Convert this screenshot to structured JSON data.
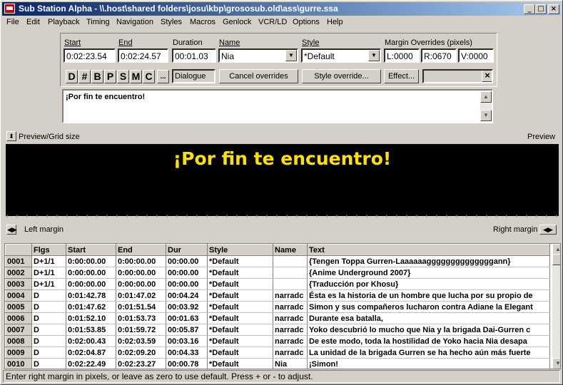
{
  "window": {
    "title": "Sub Station Alpha - \\\\.host\\shared folders\\josu\\kbp\\grososub.old\\ass\\gurre.ssa",
    "min": "_",
    "max": "□",
    "close": "×"
  },
  "menu": [
    "File",
    "Edit",
    "Playback",
    "Timing",
    "Navigation",
    "Styles",
    "Macros",
    "Genlock",
    "VCR/LD",
    "Options",
    "Help"
  ],
  "fields": {
    "start_label": "Start",
    "start": "0:02:23.54",
    "end_label": "End",
    "end": "0:02:24.57",
    "duration_label": "Duration",
    "duration": "00:01.03",
    "name_label": "Name",
    "name": "Nia",
    "style_label": "Style",
    "style": "*Default",
    "margin_label": "Margin Overrides (pixels)",
    "margin_l": "L:0000",
    "margin_r": "R:0670",
    "margin_v": "V:0000"
  },
  "tag_buttons": [
    "D",
    "#",
    "B",
    "P",
    "S",
    "M",
    "C",
    "..."
  ],
  "buttons": {
    "dialogue": "Dialogue",
    "cancel_overrides": "Cancel overrides",
    "style_override": "Style override...",
    "effect": "Effect...",
    "clear": "×"
  },
  "edit_text": "¡Por fin te encuentro!",
  "preview": {
    "grid_label": "Preview/Grid size",
    "title": "Preview",
    "text": "¡Por fin te encuentro!",
    "left_margin": "Left margin",
    "right_margin": "Right margin"
  },
  "grid": {
    "columns": [
      "",
      "Flgs",
      "Start",
      "End",
      "Dur",
      "Style",
      "Name",
      "Text"
    ],
    "rows": [
      [
        "0001",
        "D+1/1",
        "0:00:00.00",
        "0:00:00.00",
        "00:00.00",
        "*Default",
        "",
        "{Tengen Toppa Gurren-Laaaaaaggggggggggggggann}"
      ],
      [
        "0002",
        "D+1/1",
        "0:00:00.00",
        "0:00:00.00",
        "00:00.00",
        "*Default",
        "",
        "{Anime Underground 2007}"
      ],
      [
        "0003",
        "D+1/1",
        "0:00:00.00",
        "0:00:00.00",
        "00:00.00",
        "*Default",
        "",
        "{Traducción por Khosu}"
      ],
      [
        "0004",
        "D",
        "0:01:42.78",
        "0:01:47.02",
        "00:04.24",
        "*Default",
        "narradc",
        "Ésta es la historia de un hombre que lucha por su propio de"
      ],
      [
        "0005",
        "D",
        "0:01:47.62",
        "0:01:51.54",
        "00:03.92",
        "*Default",
        "narradc",
        "Simon y sus compañeros lucharon contra Adiane la Elegant"
      ],
      [
        "0006",
        "D",
        "0:01:52.10",
        "0:01:53.73",
        "00:01.63",
        "*Default",
        "narradc",
        "Durante esa batalla,"
      ],
      [
        "0007",
        "D",
        "0:01:53.85",
        "0:01:59.72",
        "00:05.87",
        "*Default",
        "narradc",
        "Yoko descubrió lo mucho que Nia y la brigada Dai-Gurren c"
      ],
      [
        "0008",
        "D",
        "0:02:00.43",
        "0:02:03.59",
        "00:03.16",
        "*Default",
        "narradc",
        "De este modo, toda la hostilidad de Yoko hacia Nia desapa"
      ],
      [
        "0009",
        "D",
        "0:02:04.87",
        "0:02:09.20",
        "00:04.33",
        "*Default",
        "narradc",
        "La unidad de la brigada Gurren se ha hecho aún más fuerte"
      ],
      [
        "0010",
        "D",
        "0:02:22.49",
        "0:02:23.27",
        "00:00.78",
        "*Default",
        "Nia",
        "¡Simon!"
      ]
    ]
  },
  "status": "Enter right margin in pixels, or leave as zero to use default. Press + or - to adjust."
}
